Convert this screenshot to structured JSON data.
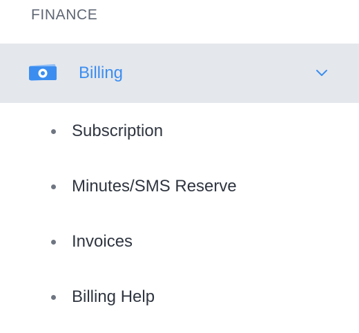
{
  "section": {
    "title": "FINANCE"
  },
  "billing": {
    "label": "Billing",
    "icon": "money-icon",
    "expand_icon": "chevron-down-icon",
    "accent_color": "#3b8ef0",
    "expanded": true,
    "items": [
      {
        "label": "Subscription"
      },
      {
        "label": "Minutes/SMS Reserve"
      },
      {
        "label": "Invoices"
      },
      {
        "label": "Billing Help"
      }
    ]
  }
}
